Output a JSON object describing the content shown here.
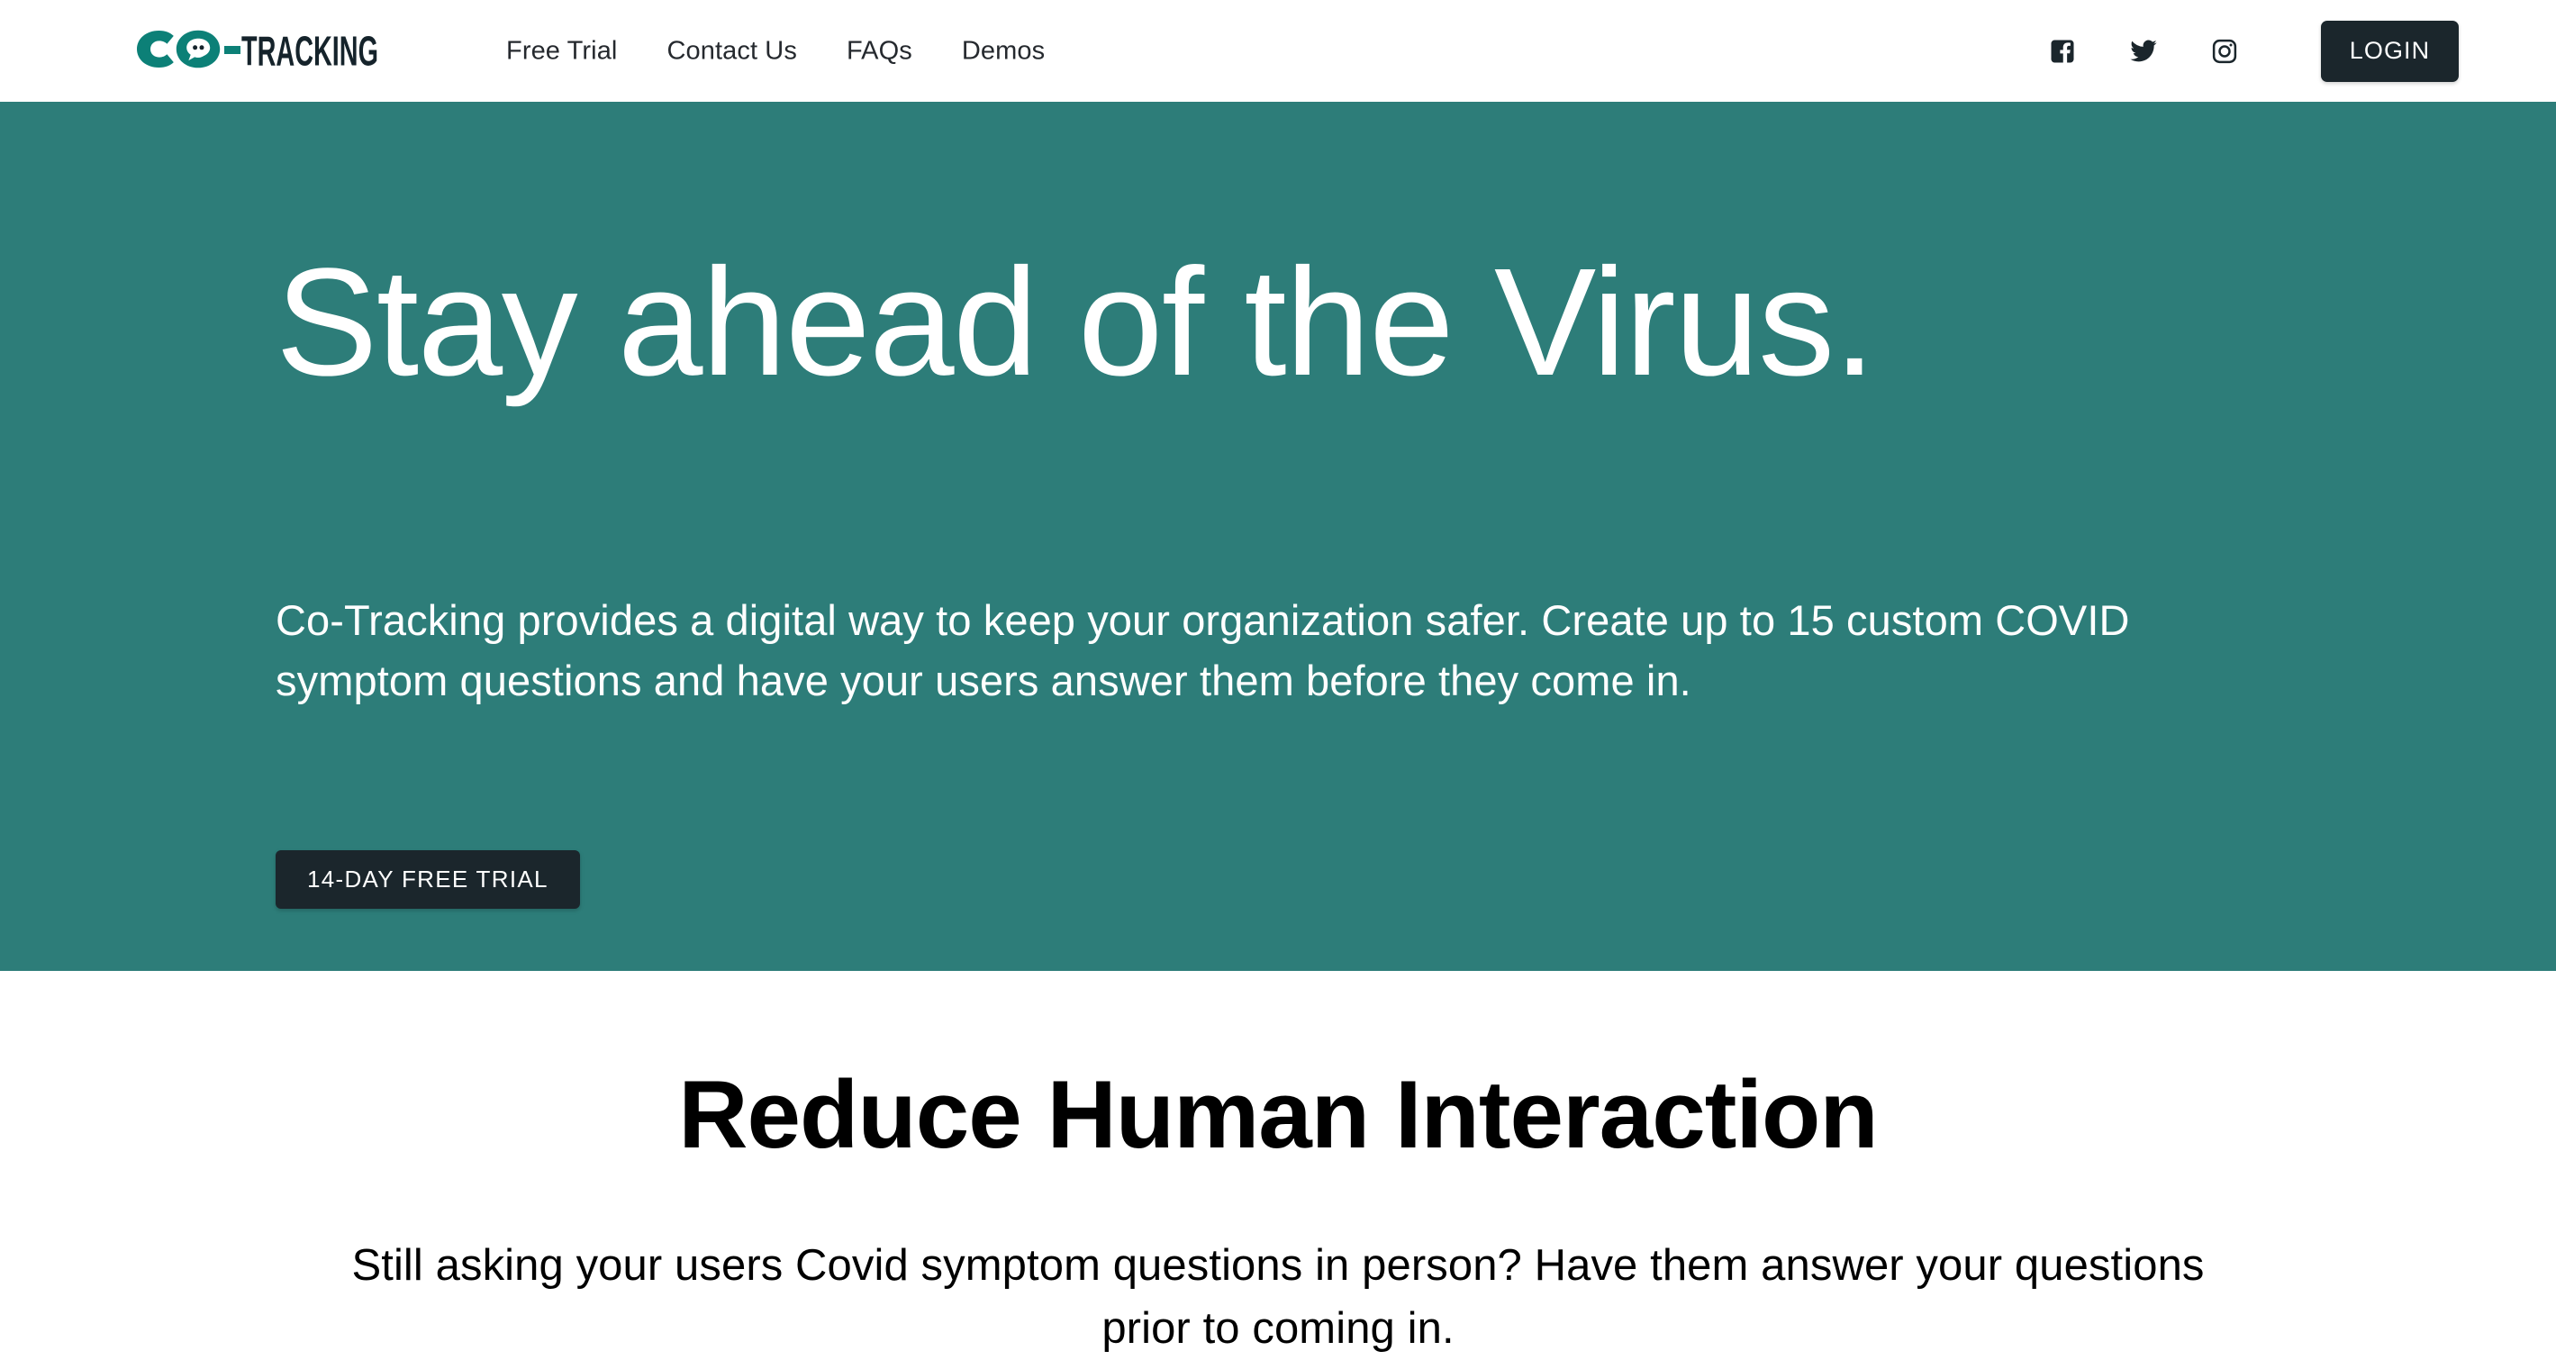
{
  "header": {
    "brand": {
      "text_teal": "CO",
      "text_dark": "-TRACKING",
      "full": "CO-TRACKING",
      "teal_color": "#0c8077",
      "dark_color": "#15232b"
    },
    "nav": [
      {
        "label": "Free Trial"
      },
      {
        "label": "Contact Us"
      },
      {
        "label": "FAQs"
      },
      {
        "label": "Demos"
      }
    ],
    "social": [
      {
        "name": "facebook",
        "label": "Facebook"
      },
      {
        "name": "twitter",
        "label": "Twitter"
      },
      {
        "name": "instagram",
        "label": "Instagram"
      }
    ],
    "login_label": "LOGIN"
  },
  "hero": {
    "title": "Stay ahead of the Virus.",
    "subtitle": "Co-Tracking provides a digital way to keep your organization safer. Create up to 15 custom COVID symptom questions and have your users answer them before they come in.",
    "cta_label": "14-DAY FREE TRIAL",
    "background_color": "#2d7d79"
  },
  "feature": {
    "title": "Reduce Human Interaction",
    "text": "Still asking your users Covid symptom questions in person? Have them answer your questions prior to coming in."
  },
  "theme": {
    "teal": "#2d7d79",
    "dark": "#1b262c",
    "white": "#ffffff",
    "brand_teal": "#0c8077"
  }
}
